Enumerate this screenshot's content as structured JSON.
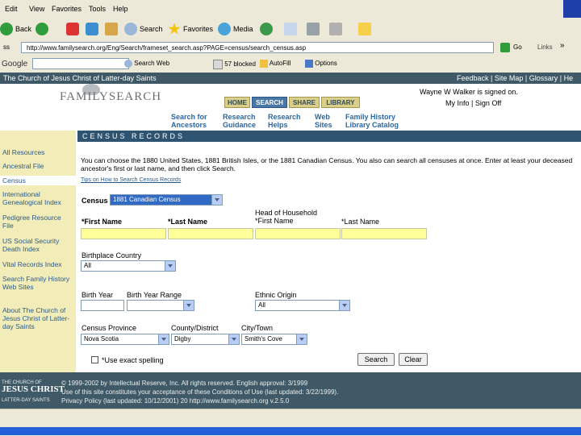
{
  "browser": {
    "menu": [
      "Edit",
      "View",
      "Favorites",
      "Tools",
      "Help"
    ],
    "toolbar": {
      "back": "Back",
      "search": "Search",
      "favorites": "Favorites",
      "media": "Media"
    },
    "address": "http://www.familysearch.org/Eng/Search/frameset_search.asp?PAGE=census/search_census.asp",
    "go": "Go",
    "links": "Links",
    "google": {
      "label": "Google",
      "search_web": "Search Web",
      "blocked": "57 blocked",
      "autofill": "AutoFill",
      "options": "Options"
    }
  },
  "site": {
    "church_name": "The Church of Jesus Christ of Latter-day Saints",
    "top_links": "Feedback | Site Map | Glossary | He",
    "logo": "FAMILYSEARCH",
    "tabs": [
      "HOME",
      "SEARCH",
      "SHARE",
      "LIBRARY"
    ],
    "signed_on": "Wayne W Walker is signed on.",
    "account": "My Info | Sign Off",
    "subnav": [
      {
        "l1": "Search for",
        "l2": "Ancestors"
      },
      {
        "l1": "Research",
        "l2": "Guidance"
      },
      {
        "l1": "Research",
        "l2": "Helps"
      },
      {
        "l1": "Web",
        "l2": "Sites"
      },
      {
        "l1": "Family History",
        "l2": "Library Catalog"
      }
    ],
    "band": "CENSUS RECORDS"
  },
  "sidebar": {
    "items": [
      "All Resources",
      "Ancestral File",
      "Census",
      "International Genealogical Index",
      "Pedigree Resource File",
      "US Social Security Death Index",
      "Vital Records Index",
      "Search Family History Web Sites",
      "About The Church of Jesus Christ of Latter-day Saints"
    ]
  },
  "form": {
    "intro": "You can choose the 1880 United States, 1881 British Isles, or the 1881 Canadian Census. You also can search all censuses at once. Enter at least your deceased ancestor's first or last name, and then click Search.",
    "tips": "Tips on How to Search Census Records",
    "census_label": "Census",
    "census_value": "1881 Canadian Census",
    "first_name": "*First Name",
    "last_name": "*Last Name",
    "hoh_first_1": "Head of Household",
    "hoh_first_2": "*First Name",
    "hoh_last": "*Last Name",
    "birthplace_label": "Birthplace Country",
    "birthplace_value": "All",
    "birth_year": "Birth Year",
    "birth_year_range": "Birth Year Range",
    "ethnic_label": "Ethnic Origin",
    "ethnic_value": "All",
    "province_label": "Census Province",
    "province_value": "Nova Scotia",
    "county_label": "County/District",
    "county_value": "Digby",
    "city_label": "City/Town",
    "city_value": "Smith's Cove",
    "exact": "*Use exact spelling",
    "search_btn": "Search",
    "clear_btn": "Clear"
  },
  "footer": {
    "church_1": "THE CHURCH OF",
    "church_2": "JESUS CHRIST",
    "church_3": "LATTER-DAY SAINTS",
    "copyright": "© 1999-2002 by Intellectual Reserve, Inc. All rights reserved. English approval: 3/1999",
    "conditions": "Use of this site constitutes your acceptance of these Conditions of Use (last updated: 3/22/1999).",
    "privacy": "Privacy Policy (last updated: 10/12/2001) 20 http://www.familysearch.org v.2.5.0"
  }
}
